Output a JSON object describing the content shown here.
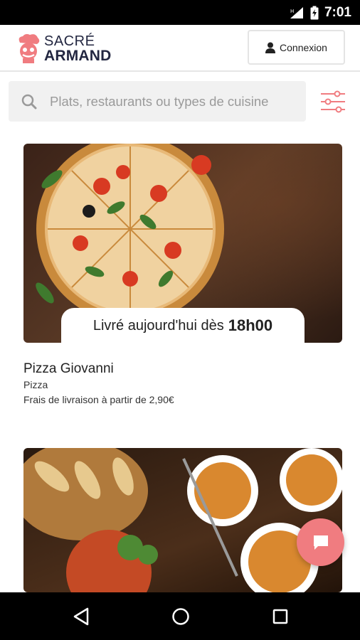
{
  "status_bar": {
    "time": "7:01"
  },
  "header": {
    "logo_line1": "SACRÉ",
    "logo_line2": "ARMAND",
    "login_label": "Connexion"
  },
  "search": {
    "placeholder": "Plats, restaurants ou types de cuisine"
  },
  "restaurants": [
    {
      "delivery_prefix": "Livré aujourd'hui dès",
      "delivery_time": "18h00",
      "name": "Pizza Giovanni",
      "category": "Pizza",
      "fee": "Frais de livraison à partir de 2,90€"
    }
  ],
  "colors": {
    "accent": "#f07c80",
    "brand_dark": "#232741"
  }
}
